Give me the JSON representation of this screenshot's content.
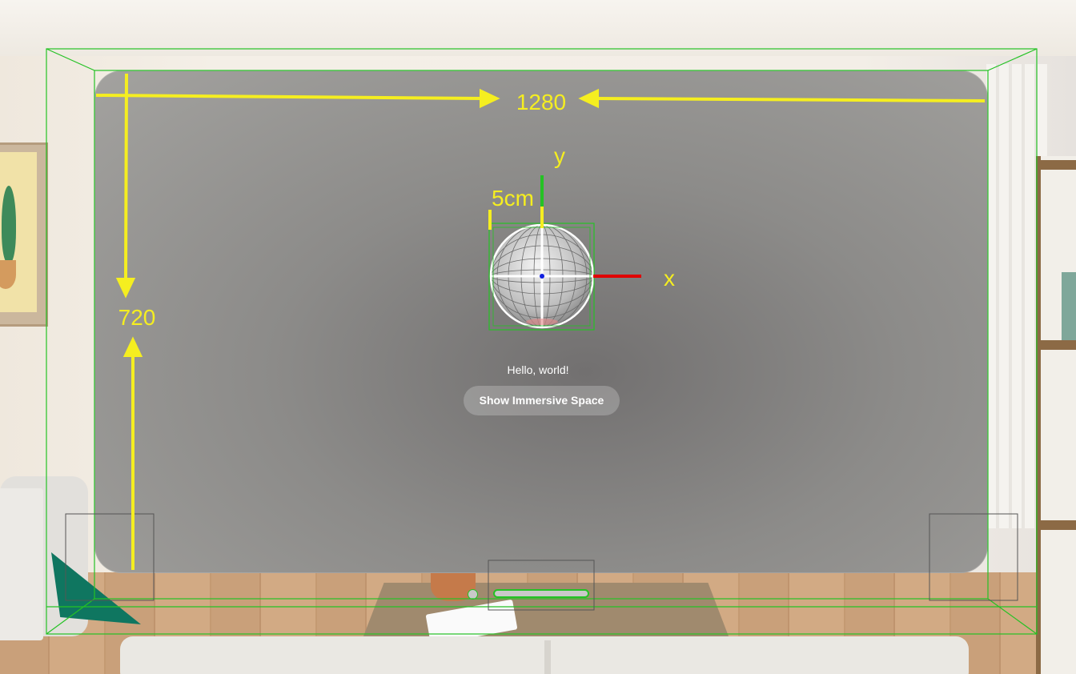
{
  "annotations": {
    "width": "1280",
    "height": "720",
    "scale": "5cm",
    "x_axis": "x",
    "y_axis": "y"
  },
  "window": {
    "greeting": "Hello, world!",
    "button_label": "Show Immersive Space"
  },
  "colors": {
    "annotation": "#f5ee20",
    "bounds": "#24c224",
    "x_axis": "#e00000",
    "y_axis": "#24c224",
    "origin": "#1020e0"
  },
  "icons": [
    "globe-sphere-icon",
    "window-close-dot-icon",
    "window-grab-bar-icon"
  ]
}
